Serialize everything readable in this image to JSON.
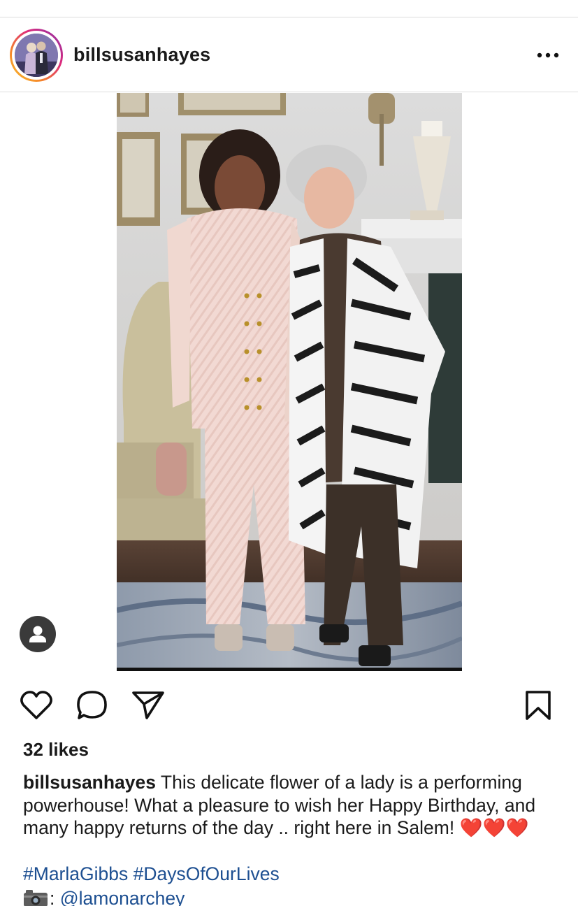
{
  "header": {
    "username": "billsusanhayes",
    "more_icon": "more-horizontal-icon"
  },
  "post": {
    "image_description_icon": "photo",
    "tag_icon": "user-tag-icon"
  },
  "actions": {
    "like_icon": "heart-outline-icon",
    "comment_icon": "comment-bubble-icon",
    "share_icon": "paper-plane-icon",
    "save_icon": "bookmark-icon"
  },
  "likes_text": "32 likes",
  "caption": {
    "username": "billsusanhayes",
    "text": "This delicate flower of a lady is a performing powerhouse!  What a pleasure to wish her Happy Birthday, and many happy returns of the day .. right here in Salem! ❤️❤️❤️"
  },
  "hashtags": "#MarlaGibbs #DaysOfOurLives",
  "credit": {
    "icon": "camera-icon",
    "separator": ":",
    "mention": "@lamonarchey"
  },
  "colors": {
    "link": "#1d4f91",
    "text": "#1a1a1a",
    "story_ring_start": "#f9c530",
    "story_ring_end": "#8134af"
  }
}
